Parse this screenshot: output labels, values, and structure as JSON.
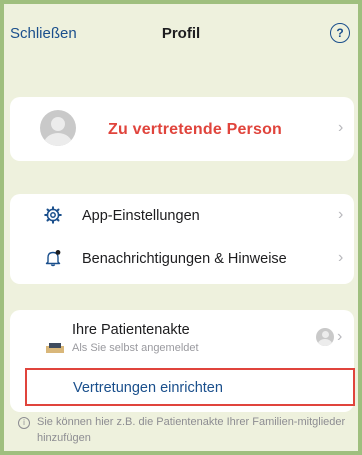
{
  "nav": {
    "close": "Schließen",
    "title": "Profil",
    "help": "?"
  },
  "person": {
    "label": "Zu vertretende Person"
  },
  "settings": {
    "items": [
      {
        "label": "App-Einstellungen",
        "icon": "gear-icon"
      },
      {
        "label": "Benachrichtigungen & Hinweise",
        "icon": "bell-icon"
      }
    ]
  },
  "record": {
    "title": "Ihre Patientenakte",
    "subtitle": "Als Sie selbst angemeldet",
    "deputy": "Vertretungen einrichten"
  },
  "info": "Sie können hier z.B. die Patientenakte Ihrer Familien-mitglieder hinzufügen",
  "colors": {
    "accent": "#1a4f8c",
    "highlight": "#e0443c",
    "frame": "#9fbf7e",
    "background": "#eef1dd"
  }
}
